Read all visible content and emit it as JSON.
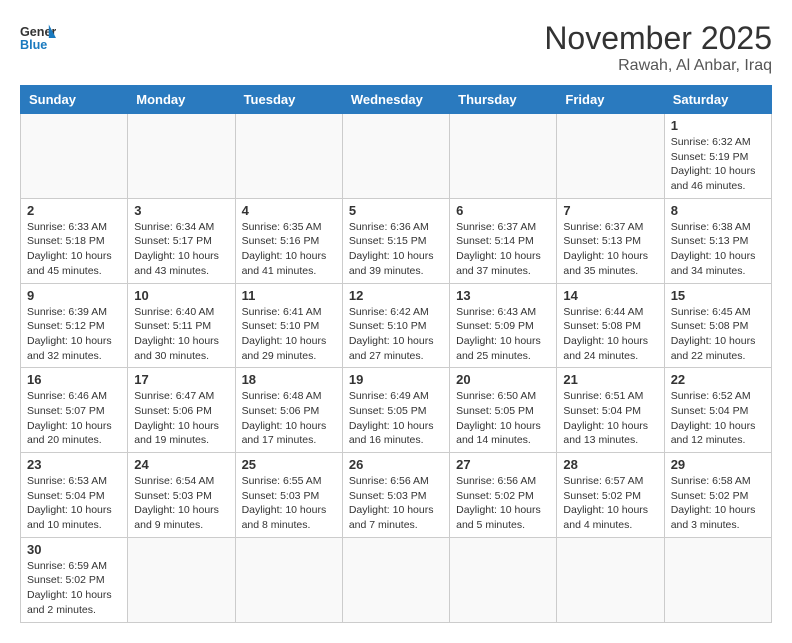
{
  "logo": {
    "general": "General",
    "blue": "Blue"
  },
  "title": "November 2025",
  "location": "Rawah, Al Anbar, Iraq",
  "weekdays": [
    "Sunday",
    "Monday",
    "Tuesday",
    "Wednesday",
    "Thursday",
    "Friday",
    "Saturday"
  ],
  "weeks": [
    [
      {
        "day": "",
        "info": ""
      },
      {
        "day": "",
        "info": ""
      },
      {
        "day": "",
        "info": ""
      },
      {
        "day": "",
        "info": ""
      },
      {
        "day": "",
        "info": ""
      },
      {
        "day": "",
        "info": ""
      },
      {
        "day": "1",
        "info": "Sunrise: 6:32 AM\nSunset: 5:19 PM\nDaylight: 10 hours and 46 minutes."
      }
    ],
    [
      {
        "day": "2",
        "info": "Sunrise: 6:33 AM\nSunset: 5:18 PM\nDaylight: 10 hours and 45 minutes."
      },
      {
        "day": "3",
        "info": "Sunrise: 6:34 AM\nSunset: 5:17 PM\nDaylight: 10 hours and 43 minutes."
      },
      {
        "day": "4",
        "info": "Sunrise: 6:35 AM\nSunset: 5:16 PM\nDaylight: 10 hours and 41 minutes."
      },
      {
        "day": "5",
        "info": "Sunrise: 6:36 AM\nSunset: 5:15 PM\nDaylight: 10 hours and 39 minutes."
      },
      {
        "day": "6",
        "info": "Sunrise: 6:37 AM\nSunset: 5:14 PM\nDaylight: 10 hours and 37 minutes."
      },
      {
        "day": "7",
        "info": "Sunrise: 6:37 AM\nSunset: 5:13 PM\nDaylight: 10 hours and 35 minutes."
      },
      {
        "day": "8",
        "info": "Sunrise: 6:38 AM\nSunset: 5:13 PM\nDaylight: 10 hours and 34 minutes."
      }
    ],
    [
      {
        "day": "9",
        "info": "Sunrise: 6:39 AM\nSunset: 5:12 PM\nDaylight: 10 hours and 32 minutes."
      },
      {
        "day": "10",
        "info": "Sunrise: 6:40 AM\nSunset: 5:11 PM\nDaylight: 10 hours and 30 minutes."
      },
      {
        "day": "11",
        "info": "Sunrise: 6:41 AM\nSunset: 5:10 PM\nDaylight: 10 hours and 29 minutes."
      },
      {
        "day": "12",
        "info": "Sunrise: 6:42 AM\nSunset: 5:10 PM\nDaylight: 10 hours and 27 minutes."
      },
      {
        "day": "13",
        "info": "Sunrise: 6:43 AM\nSunset: 5:09 PM\nDaylight: 10 hours and 25 minutes."
      },
      {
        "day": "14",
        "info": "Sunrise: 6:44 AM\nSunset: 5:08 PM\nDaylight: 10 hours and 24 minutes."
      },
      {
        "day": "15",
        "info": "Sunrise: 6:45 AM\nSunset: 5:08 PM\nDaylight: 10 hours and 22 minutes."
      }
    ],
    [
      {
        "day": "16",
        "info": "Sunrise: 6:46 AM\nSunset: 5:07 PM\nDaylight: 10 hours and 20 minutes."
      },
      {
        "day": "17",
        "info": "Sunrise: 6:47 AM\nSunset: 5:06 PM\nDaylight: 10 hours and 19 minutes."
      },
      {
        "day": "18",
        "info": "Sunrise: 6:48 AM\nSunset: 5:06 PM\nDaylight: 10 hours and 17 minutes."
      },
      {
        "day": "19",
        "info": "Sunrise: 6:49 AM\nSunset: 5:05 PM\nDaylight: 10 hours and 16 minutes."
      },
      {
        "day": "20",
        "info": "Sunrise: 6:50 AM\nSunset: 5:05 PM\nDaylight: 10 hours and 14 minutes."
      },
      {
        "day": "21",
        "info": "Sunrise: 6:51 AM\nSunset: 5:04 PM\nDaylight: 10 hours and 13 minutes."
      },
      {
        "day": "22",
        "info": "Sunrise: 6:52 AM\nSunset: 5:04 PM\nDaylight: 10 hours and 12 minutes."
      }
    ],
    [
      {
        "day": "23",
        "info": "Sunrise: 6:53 AM\nSunset: 5:04 PM\nDaylight: 10 hours and 10 minutes."
      },
      {
        "day": "24",
        "info": "Sunrise: 6:54 AM\nSunset: 5:03 PM\nDaylight: 10 hours and 9 minutes."
      },
      {
        "day": "25",
        "info": "Sunrise: 6:55 AM\nSunset: 5:03 PM\nDaylight: 10 hours and 8 minutes."
      },
      {
        "day": "26",
        "info": "Sunrise: 6:56 AM\nSunset: 5:03 PM\nDaylight: 10 hours and 7 minutes."
      },
      {
        "day": "27",
        "info": "Sunrise: 6:56 AM\nSunset: 5:02 PM\nDaylight: 10 hours and 5 minutes."
      },
      {
        "day": "28",
        "info": "Sunrise: 6:57 AM\nSunset: 5:02 PM\nDaylight: 10 hours and 4 minutes."
      },
      {
        "day": "29",
        "info": "Sunrise: 6:58 AM\nSunset: 5:02 PM\nDaylight: 10 hours and 3 minutes."
      }
    ],
    [
      {
        "day": "30",
        "info": "Sunrise: 6:59 AM\nSunset: 5:02 PM\nDaylight: 10 hours and 2 minutes."
      },
      {
        "day": "",
        "info": ""
      },
      {
        "day": "",
        "info": ""
      },
      {
        "day": "",
        "info": ""
      },
      {
        "day": "",
        "info": ""
      },
      {
        "day": "",
        "info": ""
      },
      {
        "day": "",
        "info": ""
      }
    ]
  ]
}
